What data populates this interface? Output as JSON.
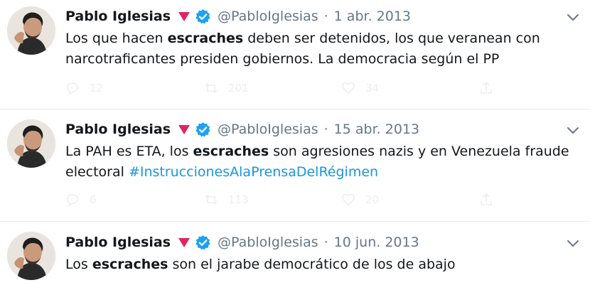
{
  "tweets": [
    {
      "name": "Pablo Iglesias",
      "handle": "@PabloIglesias",
      "date": "1 abr. 2013",
      "text_parts": {
        "a": "Los que hacen ",
        "b": "escraches",
        "c": " deben ser detenidos, los que veranean con",
        "d": "narcotraficantes presiden gobiernos. La democracia según el PP"
      },
      "counts": {
        "reply": "12",
        "retweet": "201",
        "like": "34"
      }
    },
    {
      "name": "Pablo Iglesias",
      "handle": "@PabloIglesias",
      "date": "15 abr. 2013",
      "text_parts": {
        "a": "La PAH es ETA, los ",
        "b": "escraches",
        "c": " son agresiones nazis y en Venezuela fraude",
        "d": "electoral ",
        "hashtag": "#InstruccionesAlaPrensaDelRégimen"
      },
      "counts": {
        "reply": "6",
        "retweet": "113",
        "like": "20"
      }
    },
    {
      "name": "Pablo Iglesias",
      "handle": "@PabloIglesias",
      "date": "10 jun. 2013",
      "text_parts": {
        "a": "Los ",
        "b": "escraches",
        "c": " son el jarabe democrático de los de abajo"
      }
    }
  ],
  "separator": "·",
  "colors": {
    "accent": "#1b95e0",
    "rose": "#e0245e",
    "muted": "#657786",
    "text": "#14171a"
  },
  "icons": [
    "avatar",
    "rose-emoji-icon",
    "verified-badge-icon",
    "chevron-down-icon",
    "reply-icon",
    "retweet-icon",
    "like-icon",
    "share-icon"
  ]
}
